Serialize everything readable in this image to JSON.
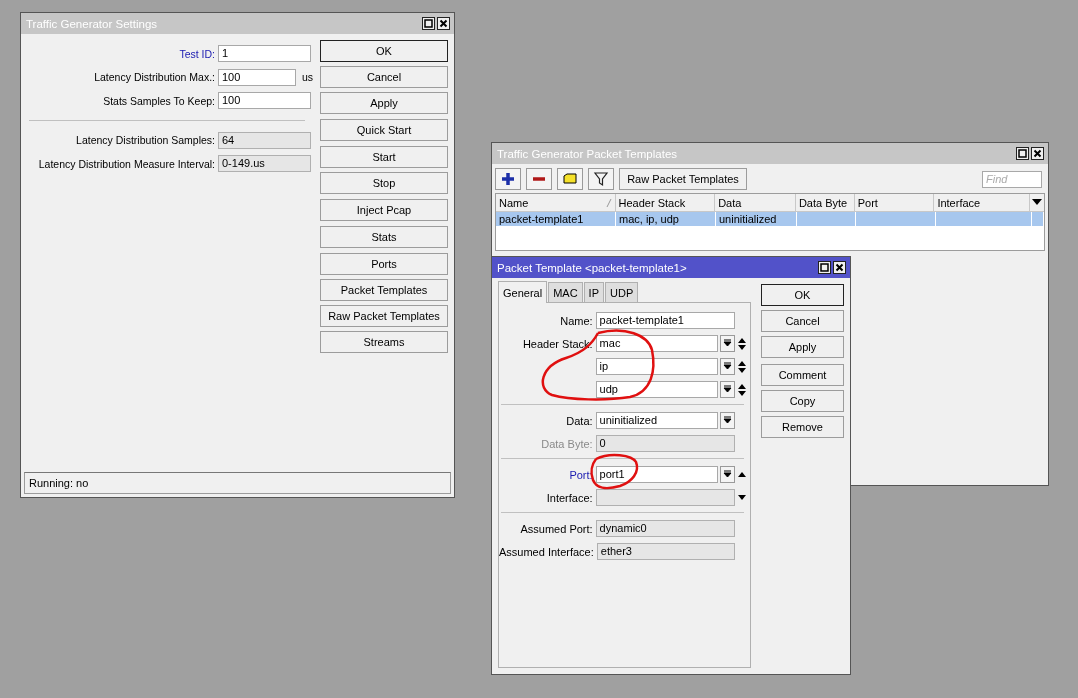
{
  "settings_window": {
    "title": "Traffic Generator Settings",
    "active": false,
    "sections": [
      [
        {
          "label": "Test ID:",
          "value": "1",
          "link": true,
          "readonly": false
        },
        {
          "label": "Latency Distribution Max.:",
          "value": "100",
          "unit": "us",
          "link": false,
          "readonly": false
        },
        {
          "label": "Stats Samples To Keep:",
          "value": "100",
          "link": false,
          "readonly": false
        }
      ],
      [
        {
          "label": "Latency Distribution Samples:",
          "value": "64",
          "link": false,
          "readonly": true
        },
        {
          "label": "Latency Distribution Measure Interval:",
          "value": "0-149.us",
          "link": false,
          "readonly": true
        }
      ]
    ],
    "button_groups": [
      [
        {
          "label": "OK",
          "default": true
        },
        {
          "label": "Cancel",
          "default": false
        },
        {
          "label": "Apply",
          "default": false
        }
      ],
      [
        {
          "label": "Quick Start",
          "default": false
        }
      ],
      [
        {
          "label": "Start",
          "default": false
        },
        {
          "label": "Stop",
          "default": false
        }
      ],
      [
        {
          "label": "Inject Pcap",
          "default": false
        }
      ],
      [
        {
          "label": "Stats",
          "default": false
        }
      ],
      [
        {
          "label": "Ports",
          "default": false
        },
        {
          "label": "Packet Templates",
          "default": false
        },
        {
          "label": "Raw Packet Templates",
          "default": false
        },
        {
          "label": "Streams",
          "default": false
        }
      ]
    ],
    "status_bar": "Running: no"
  },
  "templates_window": {
    "title": "Traffic Generator Packet Templates",
    "active": false,
    "toolbar_button": "Raw Packet Templates",
    "find": {
      "placeholder": "Find"
    },
    "columns": [
      {
        "label": "Name",
        "sorted": true
      },
      {
        "label": "Header Stack",
        "sorted": false
      },
      {
        "label": "Data",
        "sorted": false
      },
      {
        "label": "Data Byte",
        "sorted": false
      },
      {
        "label": "Port",
        "sorted": false
      },
      {
        "label": "Interface",
        "sorted": false
      }
    ],
    "rows": [
      {
        "cells": [
          "packet-template1",
          "mac, ip, udp",
          "uninitialized"
        ],
        "selected": true
      }
    ]
  },
  "template_dialog": {
    "title": "Packet Template <packet-template1>",
    "active": true,
    "tabs": [
      {
        "label": "General",
        "selected": true
      },
      {
        "label": "MAC",
        "selected": false
      },
      {
        "label": "IP",
        "selected": false
      },
      {
        "label": "UDP",
        "selected": false
      }
    ],
    "sections": [
      [
        {
          "label": "Name:",
          "values": [
            "packet-template1"
          ],
          "dropdown": false,
          "up_arrow": false,
          "down_arrow": false,
          "link": false,
          "disabled": false,
          "readonly": false
        },
        {
          "label": "Header Stack:",
          "values": [
            "mac",
            "ip",
            "udp"
          ],
          "dropdown": true,
          "up_arrow": true,
          "down_arrow": true,
          "link": false,
          "disabled": false,
          "readonly": false
        }
      ],
      [
        {
          "label": "Data:",
          "values": [
            "uninitialized"
          ],
          "dropdown": true,
          "up_arrow": false,
          "down_arrow": false,
          "link": false,
          "disabled": false,
          "readonly": false
        },
        {
          "label": "Data Byte:",
          "values": [
            "0"
          ],
          "dropdown": false,
          "up_arrow": false,
          "down_arrow": false,
          "link": false,
          "disabled": true,
          "readonly": true
        }
      ],
      [
        {
          "label": "Port:",
          "values": [
            "port1"
          ],
          "dropdown": true,
          "up_arrow": true,
          "down_arrow": false,
          "link": true,
          "disabled": false,
          "readonly": false
        },
        {
          "label": "Interface:",
          "dropdown": false,
          "up_arrow": false,
          "down_arrow": true,
          "link": false,
          "disabled": false,
          "readonly": true
        }
      ],
      [
        {
          "label": "Assumed Port:",
          "values": [
            "dynamic0"
          ],
          "dropdown": false,
          "up_arrow": false,
          "down_arrow": false,
          "link": false,
          "disabled": false,
          "readonly": true
        },
        {
          "label": "Assumed Interface:",
          "values": [
            "ether3"
          ],
          "dropdown": false,
          "up_arrow": false,
          "down_arrow": false,
          "link": false,
          "disabled": false,
          "readonly": true
        }
      ]
    ],
    "button_groups": [
      [
        {
          "label": "OK",
          "default": true
        },
        {
          "label": "Cancel",
          "default": false
        },
        {
          "label": "Apply",
          "default": false
        }
      ],
      [
        {
          "label": "Comment",
          "default": false
        },
        {
          "label": "Copy",
          "default": false
        },
        {
          "label": "Remove",
          "default": false
        }
      ]
    ]
  }
}
